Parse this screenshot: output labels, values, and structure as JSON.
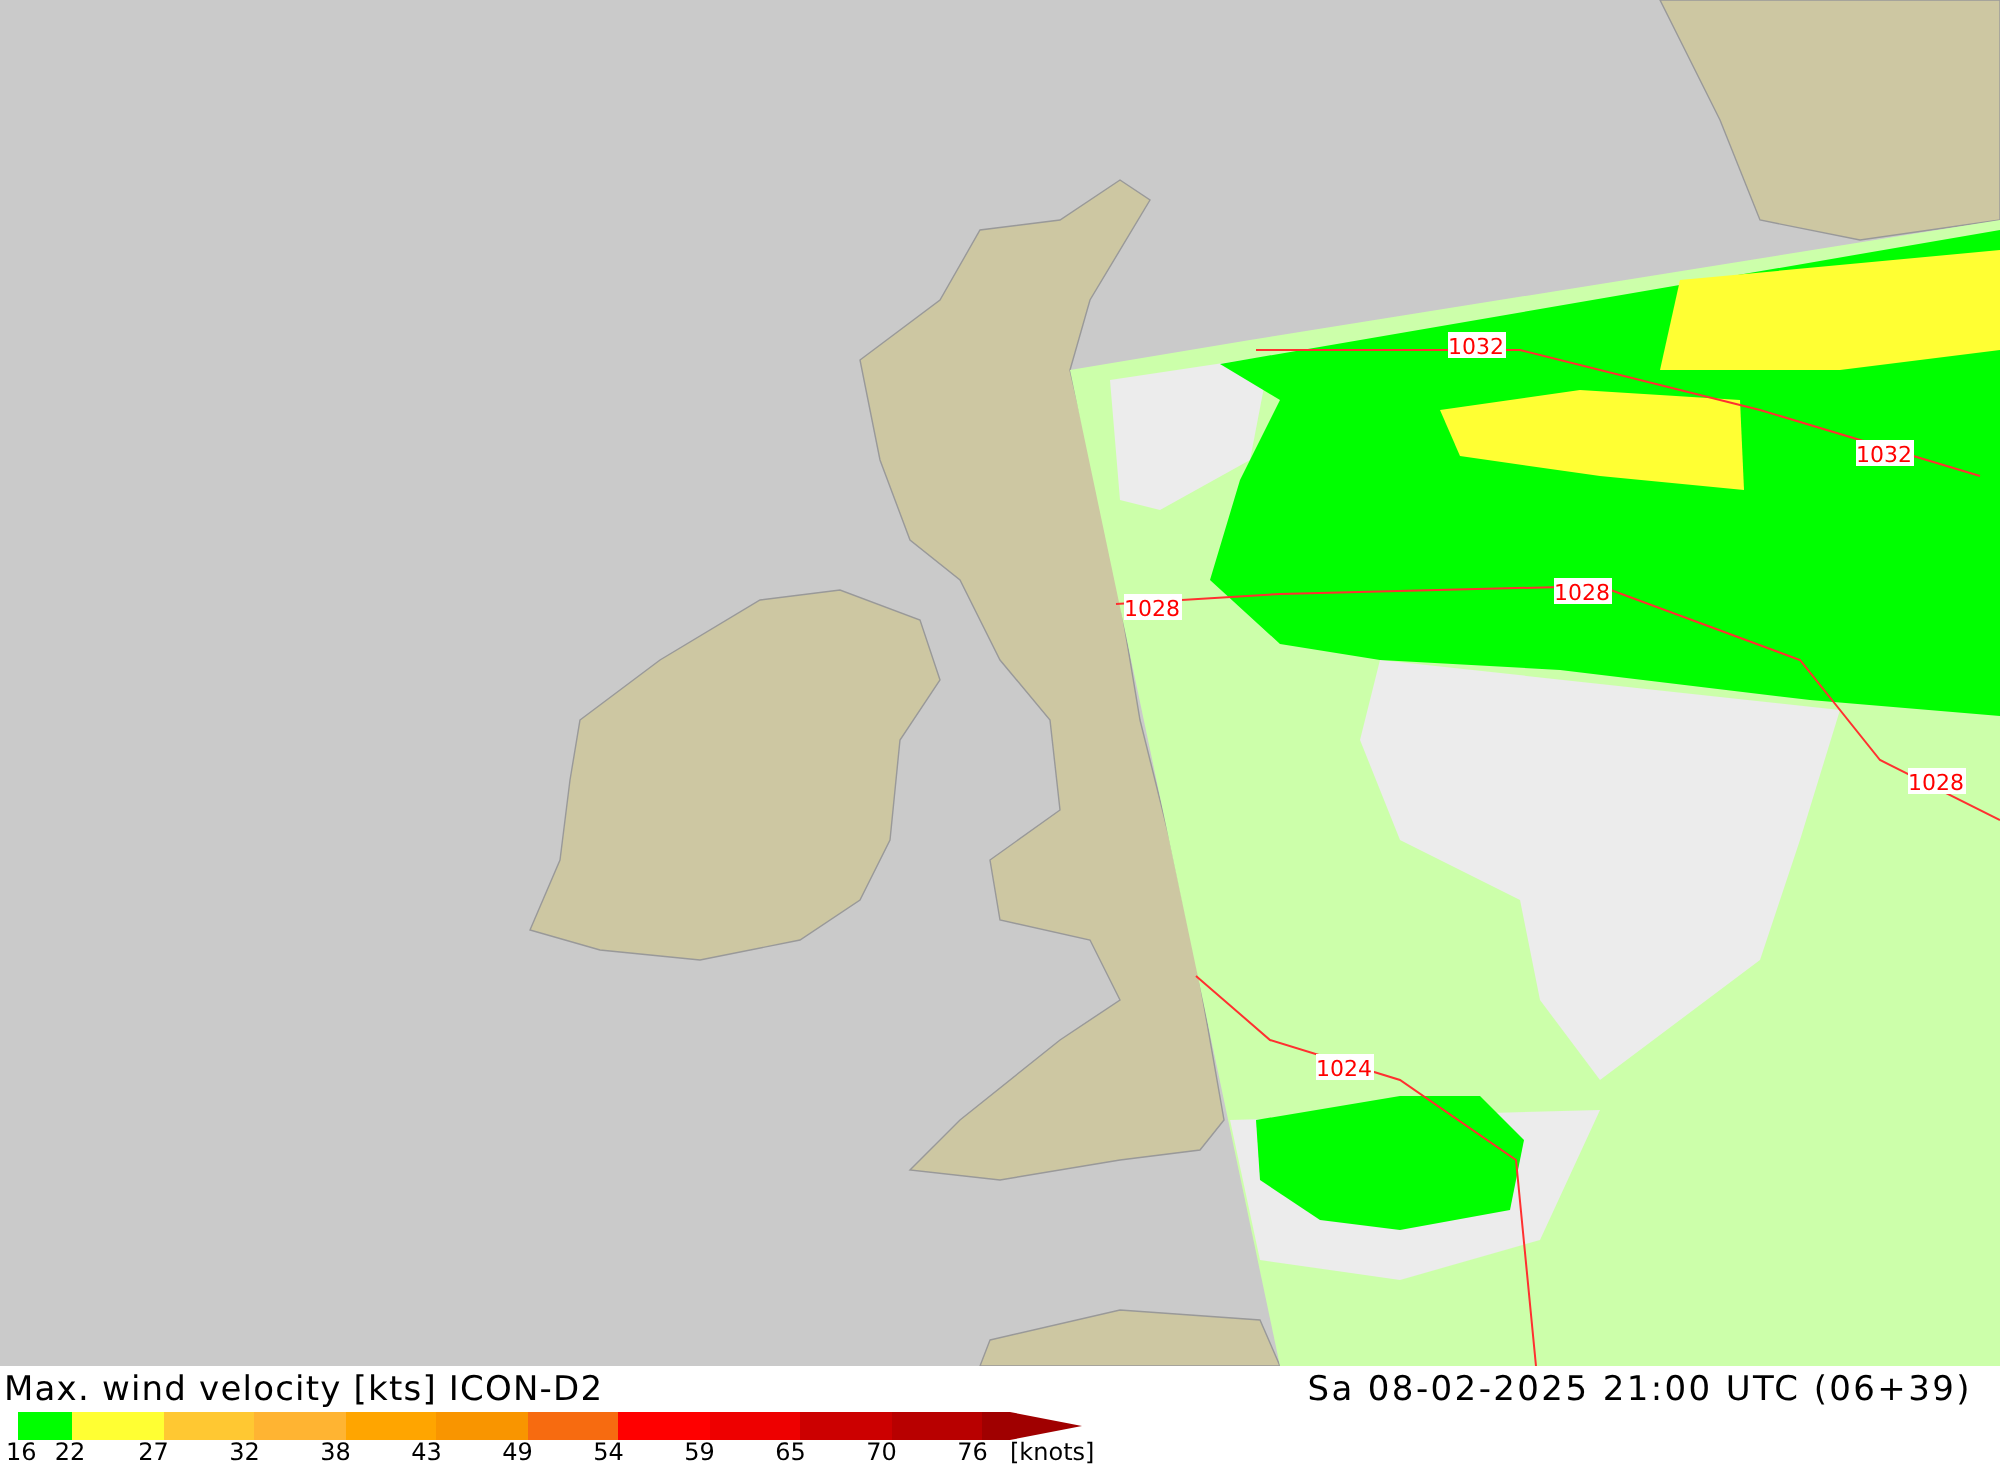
{
  "map": {
    "isobar_labels": [
      {
        "text": "1032"
      },
      {
        "text": "1032"
      },
      {
        "text": "1028"
      },
      {
        "text": "1028"
      },
      {
        "text": "1028"
      },
      {
        "text": "1024"
      }
    ]
  },
  "legend": {
    "title": "Max. wind velocity [kts] ICON-D2",
    "datetime": "Sa 08-02-2025 21:00 UTC (06+39)",
    "segments": [
      {
        "kind": "half",
        "color": "#00ff00"
      },
      {
        "kind": "step",
        "color": "#ffff33"
      },
      {
        "kind": "step",
        "color": "#ffc832"
      },
      {
        "kind": "step",
        "color": "#ffb432"
      },
      {
        "kind": "step",
        "color": "#ffa500"
      },
      {
        "kind": "step",
        "color": "#f99500"
      },
      {
        "kind": "step",
        "color": "#f76b10"
      },
      {
        "kind": "step",
        "color": "#ff0000"
      },
      {
        "kind": "step",
        "color": "#ee0000"
      },
      {
        "kind": "step",
        "color": "#cc0000"
      },
      {
        "kind": "step",
        "color": "#b80000"
      },
      {
        "kind": "arrow",
        "color": "#a00000"
      }
    ],
    "ticks": [
      "16",
      "22",
      "27",
      "32",
      "38",
      "43",
      "49",
      "54",
      "59",
      "65",
      "70",
      "76"
    ],
    "unit": "[knots]"
  }
}
